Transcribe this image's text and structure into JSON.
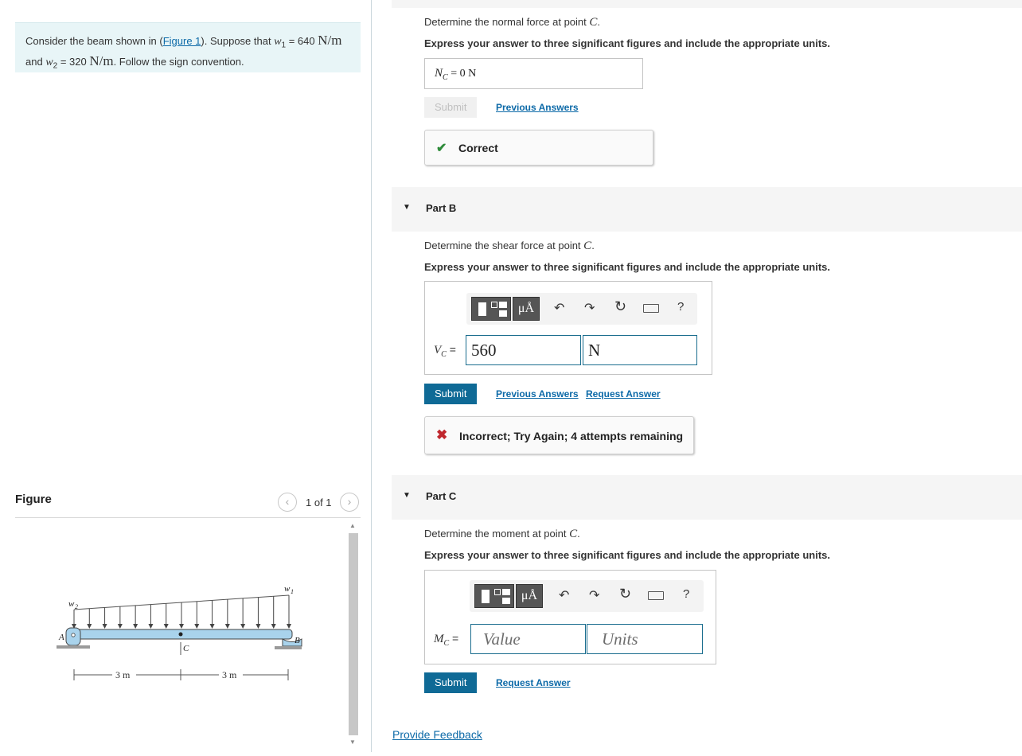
{
  "problem": {
    "intro": "Consider the beam shown in (",
    "figure_link": "Figure 1",
    "mid": "). Suppose that ",
    "w1_sym": "w",
    "w1_sub": "1",
    "eq1": " = 640 ",
    "unit1": "N/m",
    "and": "and ",
    "w2_sym": "w",
    "w2_sub": "2",
    "eq2": " = 320 ",
    "unit2": "N/m",
    "tail": ". Follow the sign convention."
  },
  "figure": {
    "title": "Figure",
    "counter": "1 of 1",
    "prev_icon": "chevron-left-icon",
    "next_icon": "chevron-right-icon",
    "labels": {
      "w1": "w",
      "w1_sub": "1",
      "w2": "w",
      "w2_sub": "2",
      "A": "A",
      "B": "B",
      "C": "C",
      "dim_left": "3 m",
      "dim_right": "3 m"
    }
  },
  "part_a": {
    "question_prefix": "Determine the normal force at point ",
    "question_var": "C",
    "question_suffix": ".",
    "instruction": "Express your answer to three significant figures and include the appropriate units.",
    "answer_var": "N",
    "answer_sub": "C",
    "answer_text": " = 0 N",
    "submit_label": "Submit",
    "previous_answers": "Previous Answers",
    "feedback": "Correct",
    "feedback_color": "#2e8b3a"
  },
  "part_b": {
    "header": "Part B",
    "question_prefix": "Determine the shear force at point ",
    "question_var": "C",
    "question_suffix": ".",
    "instruction": "Express your answer to three significant figures and include the appropriate units.",
    "var": "V",
    "var_sub": "C",
    "eq": " =",
    "value": "560",
    "units": "N",
    "submit_label": "Submit",
    "previous_answers": "Previous Answers",
    "request_answer": "Request Answer",
    "feedback": "Incorrect; Try Again; 4 attempts remaining",
    "feedback_color": "#c0272d"
  },
  "part_c": {
    "header": "Part C",
    "question_prefix": "Determine the moment at point ",
    "question_var": "C",
    "question_suffix": ".",
    "instruction": "Express your answer to three significant figures and include the appropriate units.",
    "var": "M",
    "var_sub": "C",
    "eq": " =",
    "value_placeholder": "Value",
    "units_placeholder": "Units",
    "submit_label": "Submit",
    "request_answer": "Request Answer"
  },
  "toolbar": {
    "templates_icon": "fraction-template-icon",
    "units_label": "μÅ",
    "undo_icon": "undo-icon",
    "redo_icon": "redo-icon",
    "reset_icon": "reset-icon",
    "keyboard_icon": "keyboard-icon",
    "help_label": "?"
  },
  "footer": {
    "provide_feedback": "Provide Feedback"
  },
  "colors": {
    "accent": "#0f6a96",
    "link": "#0d6aa8",
    "problem_bg": "#e8f5f7",
    "beam": "#a9d3ec"
  }
}
